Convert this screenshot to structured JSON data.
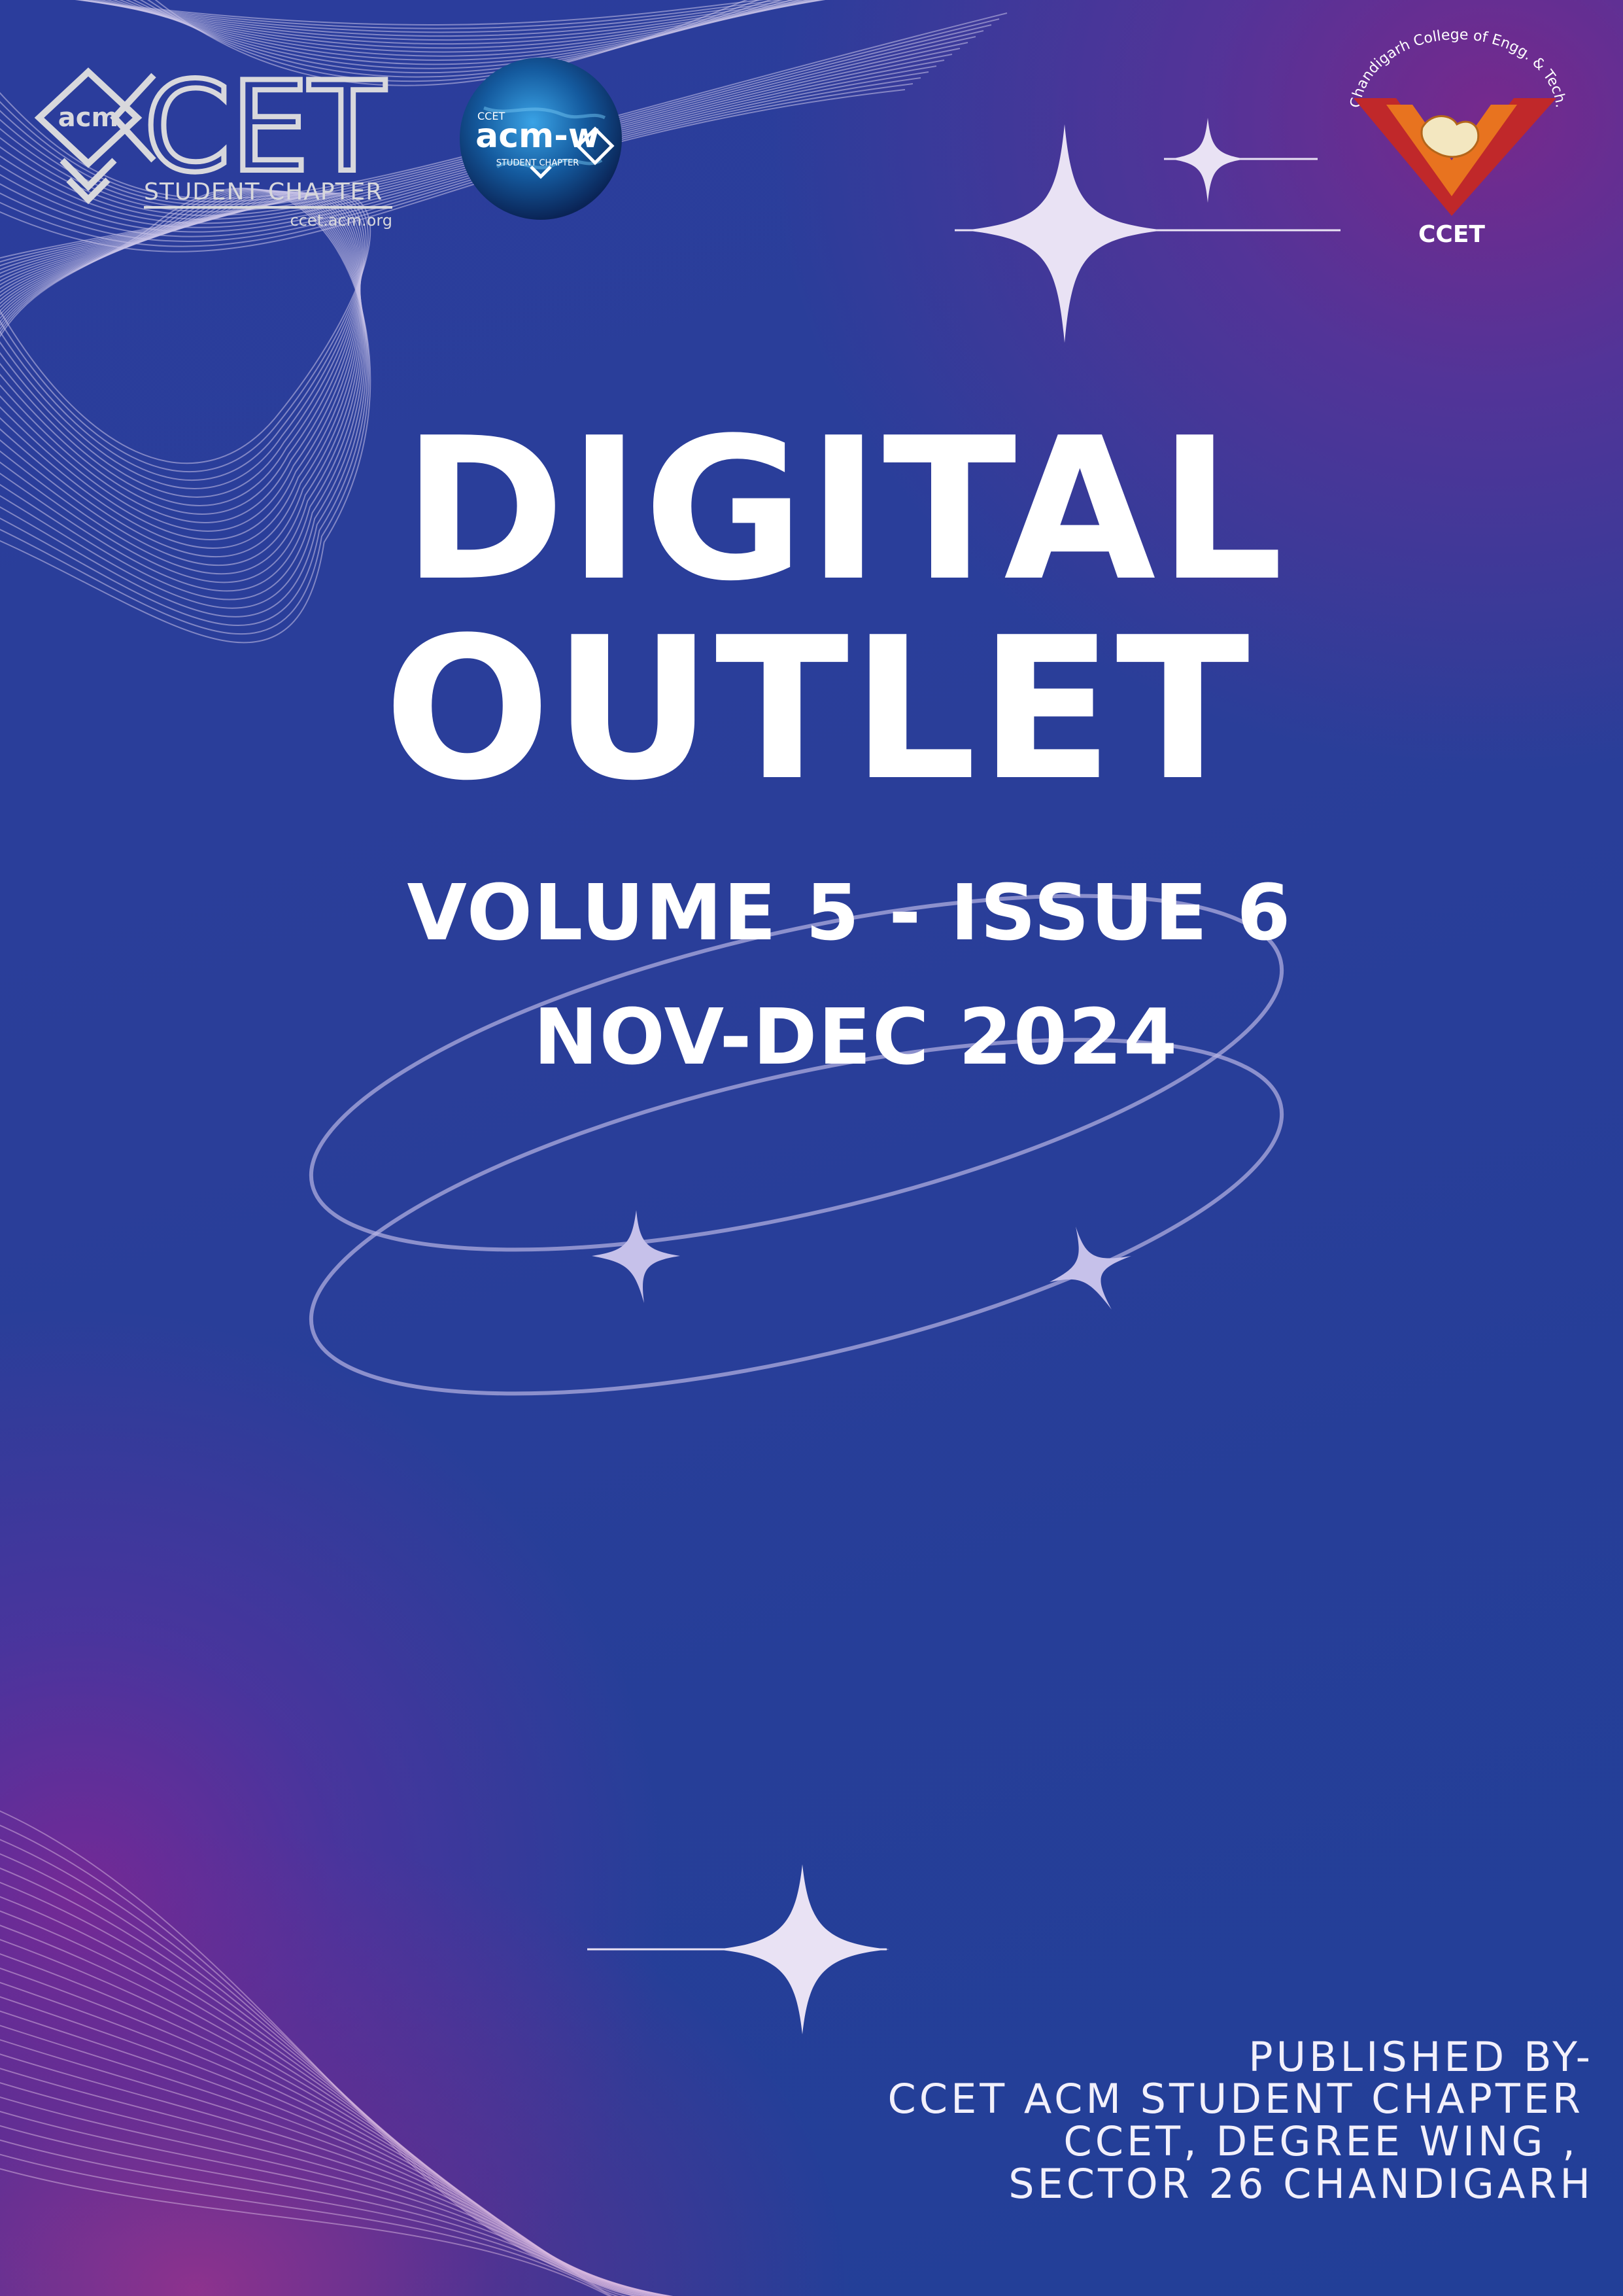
{
  "cover": {
    "title_line_1": "DIGITAL",
    "title_line_2": "OUTLET",
    "issue": "VOLUME 5 - ISSUE 6",
    "date": "NOV-DEC 2024"
  },
  "publisher": {
    "line_1": "PUBLISHED BY-",
    "line_2": "CCET ACM STUDENT CHAPTER",
    "line_3": "CCET, DEGREE WING ,",
    "line_4": "SECTOR 26 CHANDIGARH"
  },
  "logos": {
    "acm": {
      "acm_text": "acm",
      "cet_text": "CET",
      "chapter_text": "STUDENT CHAPTER",
      "url_text": "ccet.acm.org"
    },
    "acmw": {
      "top_text": "CCET",
      "main_text": "acm-w",
      "bottom_text": "STUDENT CHAPTER"
    },
    "college": {
      "arc_text": "Chandigarh College of Engg. & Tech.",
      "short_name": "CCET"
    }
  },
  "colors": {
    "background_blue": "#2a3e99",
    "glow_purple": "#7a288c",
    "text": "#ffffff",
    "line_art": "#c9c3e8",
    "emblem_red": "#c0282a",
    "emblem_orange": "#e8731f"
  }
}
